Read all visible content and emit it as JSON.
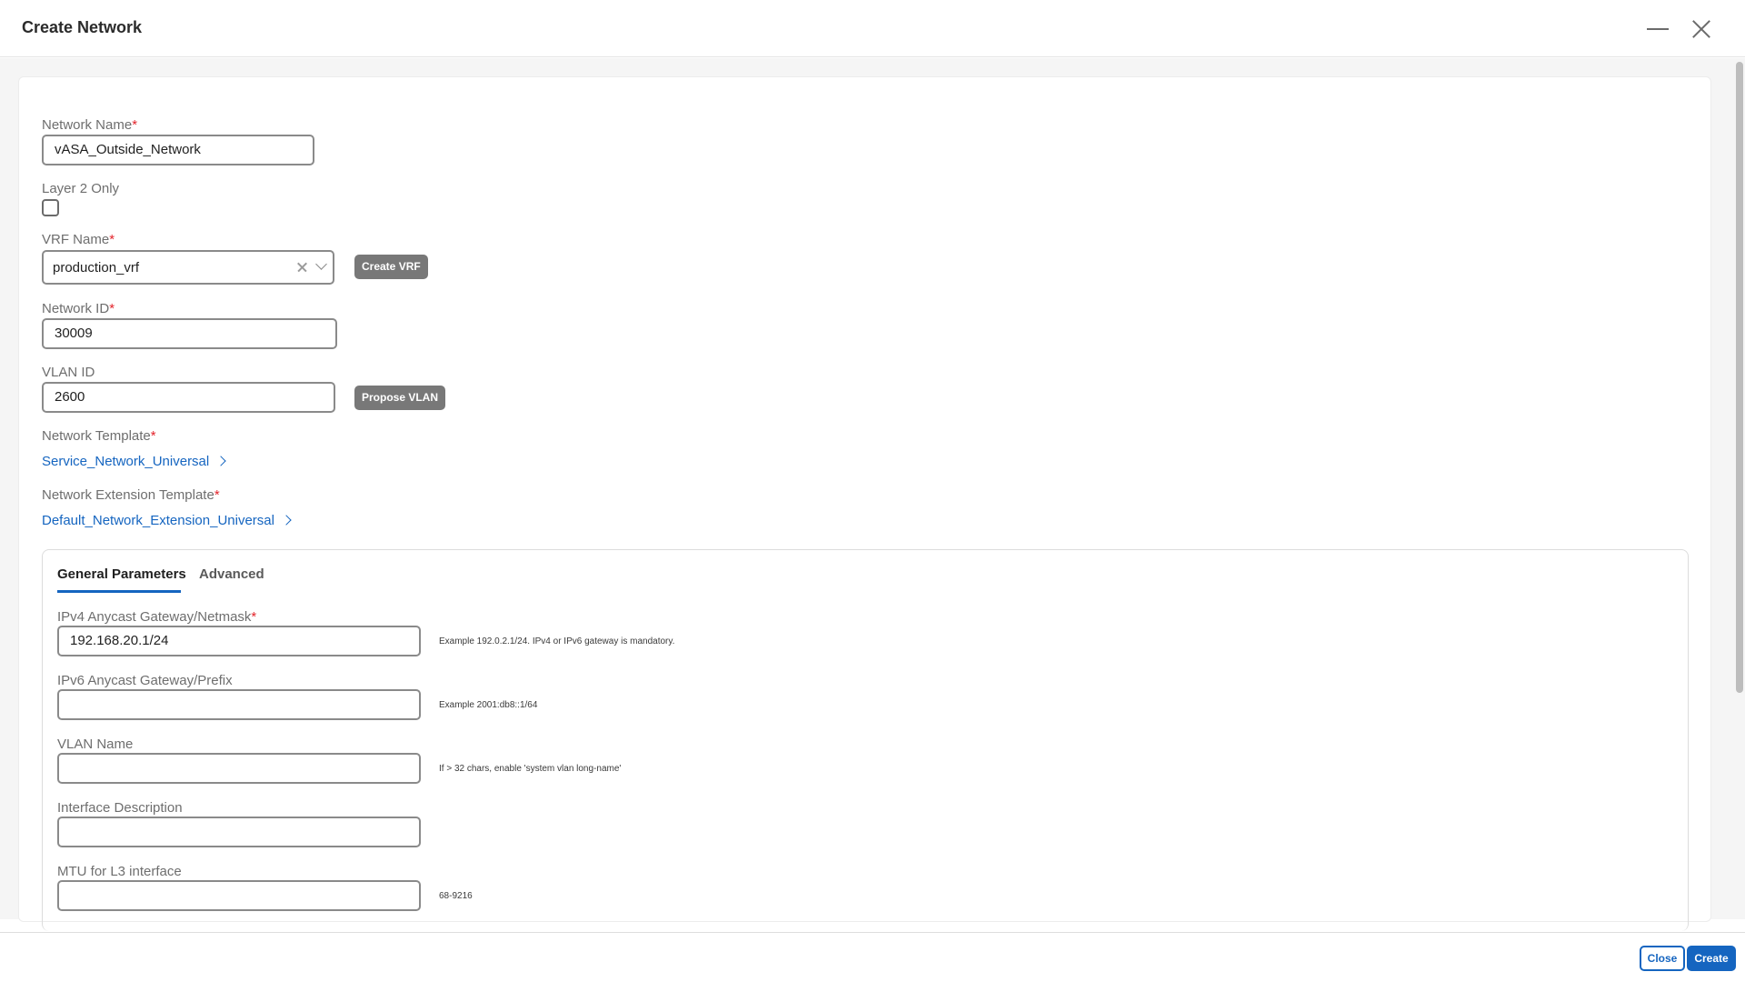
{
  "header": {
    "title": "Create Network"
  },
  "form": {
    "network_name": {
      "label": "Network Name",
      "required": "*",
      "value": "vASA_Outside_Network"
    },
    "layer2_only": {
      "label": "Layer 2 Only"
    },
    "vrf_name": {
      "label": "VRF Name",
      "required": "*",
      "value": "production_vrf",
      "create_button": "Create VRF"
    },
    "network_id": {
      "label": "Network ID",
      "required": "*",
      "value": "30009"
    },
    "vlan_id": {
      "label": "VLAN ID",
      "value": "2600",
      "propose_button": "Propose VLAN"
    },
    "network_template": {
      "label": "Network Template",
      "required": "*",
      "value": "Service_Network_Universal"
    },
    "network_extension_template": {
      "label": "Network Extension Template",
      "required": "*",
      "value": "Default_Network_Extension_Universal"
    }
  },
  "tabs": [
    {
      "label": "General Parameters",
      "active": true
    },
    {
      "label": "Advanced",
      "active": false
    }
  ],
  "general": {
    "ipv4": {
      "label": "IPv4 Anycast Gateway/Netmask",
      "required": "*",
      "value": "192.168.20.1/24",
      "hint": "Example 192.0.2.1/24. IPv4 or IPv6 gateway is mandatory."
    },
    "ipv6": {
      "label": "IPv6 Anycast Gateway/Prefix",
      "value": "",
      "hint": "Example 2001:db8::1/64"
    },
    "vlan_name": {
      "label": "VLAN Name",
      "value": "",
      "hint": "If > 32 chars, enable 'system vlan long-name'"
    },
    "interface_description": {
      "label": "Interface Description",
      "value": ""
    },
    "mtu": {
      "label": "MTU for L3 interface",
      "value": "",
      "hint": "68-9216"
    }
  },
  "footer": {
    "close_label": "Close",
    "create_label": "Create"
  },
  "colors": {
    "accent": "#1565c0",
    "required": "#e3242b",
    "gray_button": "#787878"
  }
}
